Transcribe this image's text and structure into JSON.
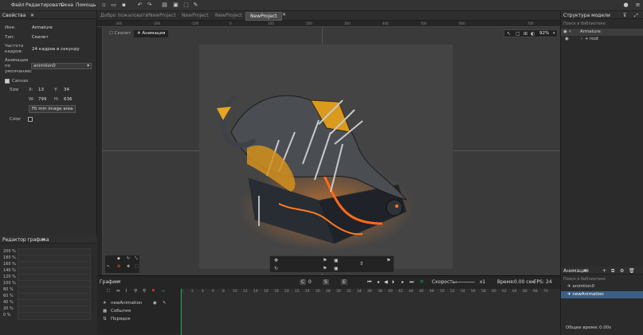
{
  "menu": {
    "items": [
      "Файл",
      "Редактировать",
      "Окна",
      "Помощь"
    ]
  },
  "tabs": [
    {
      "label": "Добро пожаловать",
      "active": false
    },
    {
      "label": "*NewProject",
      "active": false
    },
    {
      "label": "NewProject",
      "active": false
    },
    {
      "label": "NewProject",
      "active": false
    },
    {
      "label": "NewProject",
      "active": true
    }
  ],
  "properties": {
    "title": "Свойства",
    "name_label": "Имя:",
    "name_value": "Armature",
    "type_label": "Тип:",
    "type_value": "Скелет",
    "fps_label": "Частота кадров:",
    "fps_value": "24 кадров в секунду",
    "default_anim_label": "Анимация по умолчанию:",
    "default_anim_value": "animtion0",
    "canvas_label": "Canvas",
    "size_label": "Size",
    "x_label": "X:",
    "x_value": "13",
    "y_label": "Y:",
    "y_value": "34",
    "w_label": "W:",
    "w_value": "799",
    "h_label": "H:",
    "h_value": "636",
    "fit_button": "Fit min image area",
    "color_label": "Color"
  },
  "graph_editor": {
    "title": "Редактор графика",
    "percents": [
      "200 %",
      "180 %",
      "160 %",
      "140 %",
      "120 %",
      "100 %",
      "80 %",
      "60 %",
      "40 %",
      "20 %",
      "0 %"
    ]
  },
  "viewport": {
    "mode_tabs": [
      "Скелет",
      "Анимация"
    ],
    "active_mode": "Анимация",
    "zoom": "92%",
    "ruler_marks": [
      "-300",
      "-200",
      "-100",
      "0",
      "100",
      "200",
      "300",
      "400",
      "500",
      "600",
      "700"
    ]
  },
  "model_structure": {
    "title": "Структура модели",
    "search_placeholder": "Поиск в библиотеке",
    "items": [
      "Armature",
      "root"
    ]
  },
  "animation_panel": {
    "title": "Анимация",
    "search_placeholder": "Поиск в библиотеке",
    "items": [
      "animtion0",
      "newAnimation"
    ],
    "total_time_label": "Общее время:",
    "total_time_value": "0.00s"
  },
  "timeline": {
    "title": "График",
    "frame_start": "0",
    "speed_label": "Скорость:",
    "speed_value": "x1",
    "time_label": "Время:",
    "time_value": "0.00 сек.",
    "fps_label": "FPS:",
    "fps_value": "24",
    "frame_numbers": [
      "0",
      "2",
      "4",
      "6",
      "8",
      "10",
      "12",
      "14",
      "16",
      "18",
      "20",
      "22",
      "24",
      "26",
      "28",
      "30",
      "32",
      "34",
      "36",
      "38",
      "40",
      "42",
      "44",
      "46",
      "48",
      "50",
      "52",
      "54",
      "56",
      "58",
      "60",
      "62",
      "64",
      "66",
      "68",
      "70"
    ],
    "layers": [
      "newAnimation",
      "События",
      "Порядок"
    ]
  },
  "colors": {
    "accent": "#1fa84f",
    "active_tab": "#4a4a4a",
    "selection": "#3b5f84"
  }
}
